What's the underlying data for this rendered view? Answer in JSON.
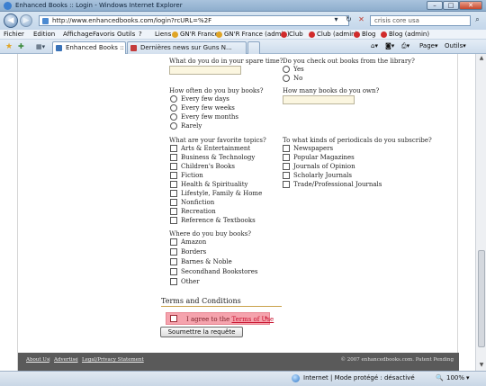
{
  "window": {
    "title": "Enhanced Books :: Login - Windows Internet Explorer",
    "controls": {
      "minimize": "–",
      "maximize": "□",
      "close": "✕"
    }
  },
  "address_bar": {
    "url": "http://www.enhancedbooks.com/login?rcURL=%2F",
    "search_value": "crisis core usa"
  },
  "menu": {
    "items": [
      "Fichier",
      "Edition",
      "Affichage",
      "Favoris",
      "Outils",
      "?"
    ],
    "links_label": "Liens",
    "links": [
      "GN'R France",
      "GN'R France (admin)",
      "Club",
      "Club (admin)",
      "Blog",
      "Blog (admin)"
    ]
  },
  "tabs": {
    "items": [
      {
        "label": "Enhanced Books :: Login",
        "active": true
      },
      {
        "label": "Dernières news sur Guns N...",
        "active": false
      }
    ],
    "tools": {
      "page": "Page",
      "outils": "Outils"
    }
  },
  "form": {
    "spare_time_q": "What do you do in your spare time?",
    "library_q": "Do you check out books from the library?",
    "library_options": [
      "Yes",
      "No"
    ],
    "buy_freq_q": "How often do you buy books?",
    "buy_freq_options": [
      "Every few days",
      "Every few weeks",
      "Every few months",
      "Rarely"
    ],
    "own_q": "How many books do you own?",
    "topics_q": "What are your favorite topics?",
    "topics": [
      "Arts & Entertainment",
      "Business & Technology",
      "Children's Books",
      "Fiction",
      "Health & Spirituality",
      "Lifestyle, Family & Home",
      "Nonfiction",
      "Recreation",
      "Reference & Textbooks"
    ],
    "periodicals_q": "To what kinds of periodicals do you subscribe?",
    "periodicals": [
      "Newspapers",
      "Popular Magazines",
      "Journals of Opinion",
      "Scholarly Journals",
      "Trade/Professional Journals"
    ],
    "where_q": "Where do you buy books?",
    "where_options": [
      "Amazon",
      "Borders",
      "Barnes & Noble",
      "Secondhand Bookstores",
      "Other"
    ],
    "terms_title": "Terms and Conditions",
    "agree_prefix": "I agree to the ",
    "agree_link": "Terms of Use",
    "agree_required": "*",
    "submit_label": "Soumettre la requête"
  },
  "footer": {
    "links": [
      "About Us",
      "Advertise",
      "Legal/Privacy Statement"
    ],
    "separator": "|",
    "copyright": "© 2007 enhancedbooks.com. Patent Pending"
  },
  "status": {
    "zone": "Internet | Mode protégé : désactivé",
    "zoom": "100%"
  },
  "colors": {
    "terms_highlight": "#f5a3ad",
    "link_red": "#c8102e",
    "footer_bg": "#5a5a5a"
  }
}
